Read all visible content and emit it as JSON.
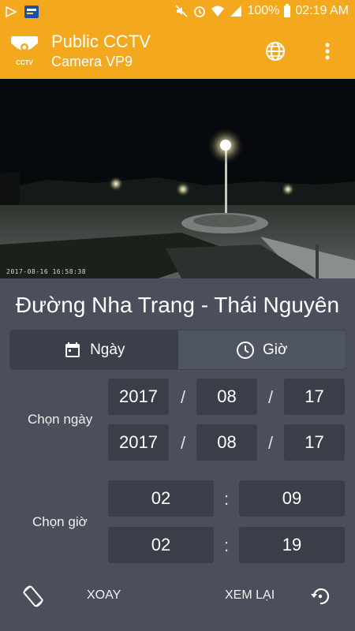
{
  "status_bar": {
    "battery": "100%",
    "time": "02:19 AM"
  },
  "app_bar": {
    "title": "Public CCTV",
    "subtitle": "Camera VP9",
    "logo_text": "CCTV"
  },
  "video": {
    "timestamp": "2017-08-16 16:58:38"
  },
  "location": {
    "name": "Đường Nha Trang - Thái Nguyên"
  },
  "tabs": [
    {
      "label": "Ngày",
      "icon": "calendar-icon",
      "active": true
    },
    {
      "label": "Giờ",
      "icon": "clock-icon",
      "active": false
    }
  ],
  "date_picker": {
    "label": "Chọn ngày",
    "separator": "/",
    "rows": [
      {
        "year": "2017",
        "month": "08",
        "day": "17"
      },
      {
        "year": "2017",
        "month": "08",
        "day": "17"
      }
    ]
  },
  "time_picker": {
    "label": "Chọn giờ",
    "separator": ":",
    "rows": [
      {
        "hour": "02",
        "minute": "09"
      },
      {
        "hour": "02",
        "minute": "19"
      }
    ]
  },
  "bottom_bar": {
    "rotate_label": "XOAY",
    "replay_label": "XEM LẠI"
  },
  "colors": {
    "accent": "#f3a81d",
    "background": "#4a4f5b",
    "field": "#3a3e48"
  }
}
